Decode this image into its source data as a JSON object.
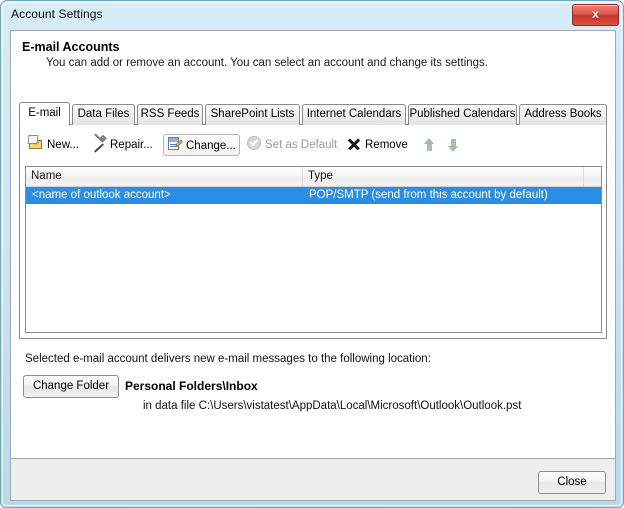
{
  "window": {
    "title": "Account Settings",
    "close_label": "x"
  },
  "header": {
    "title": "E-mail Accounts",
    "subtitle": "You can add or remove an account. You can select an account and change its settings."
  },
  "tabs": [
    {
      "label": "E-mail",
      "active": true
    },
    {
      "label": "Data Files",
      "active": false
    },
    {
      "label": "RSS Feeds",
      "active": false
    },
    {
      "label": "SharePoint Lists",
      "active": false
    },
    {
      "label": "Internet Calendars",
      "active": false
    },
    {
      "label": "Published Calendars",
      "active": false
    },
    {
      "label": "Address Books",
      "active": false
    }
  ],
  "toolbar": {
    "new_label": "New...",
    "repair_label": "Repair...",
    "change_label": "Change...",
    "set_default_label": "Set as Default",
    "remove_label": "Remove",
    "move_up_label": "",
    "move_down_label": ""
  },
  "accounts_list": {
    "columns": [
      "Name",
      "Type",
      ""
    ],
    "rows": [
      {
        "name": "<name of outlook account>",
        "type": "POP/SMTP (send from this account by default)",
        "selected": true
      }
    ]
  },
  "delivery": {
    "note": "Selected e-mail account delivers new e-mail messages to the following location:",
    "change_folder_label": "Change Folder",
    "folder_name": "Personal Folders\\Inbox",
    "folder_path": "in data file C:\\Users\\vistatest\\AppData\\Local\\Microsoft\\Outlook\\Outlook.pst"
  },
  "footer": {
    "close_label": "Close"
  },
  "colors": {
    "selection": "#2a8ee6",
    "frame": "#cfe6f5",
    "close_button": "#c9352b"
  }
}
